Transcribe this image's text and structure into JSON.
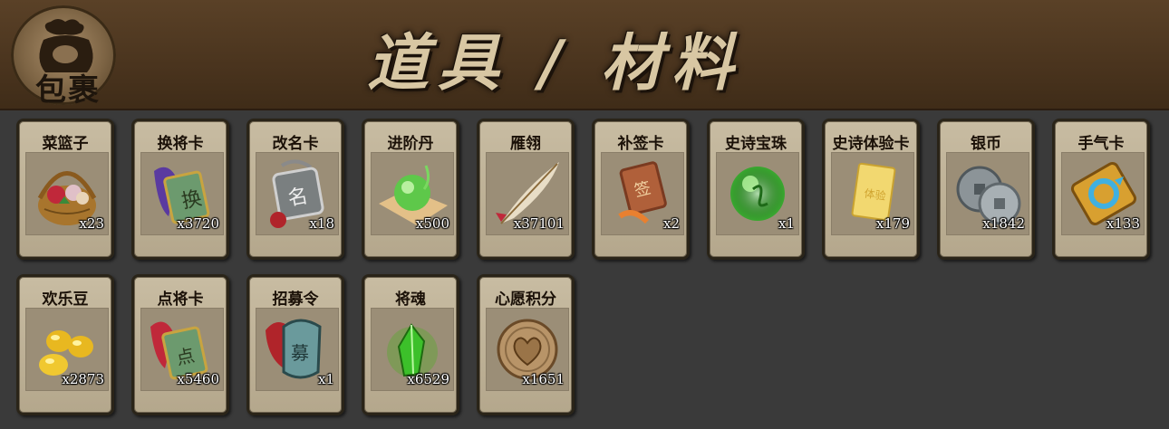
{
  "header": {
    "bag_label": "包裹",
    "title": "道具 / 材料"
  },
  "items": [
    {
      "name": "菜篮子",
      "count": "x23",
      "icon": "basket-icon"
    },
    {
      "name": "换将卡",
      "count": "x3720",
      "icon": "swap-card-icon"
    },
    {
      "name": "改名卡",
      "count": "x18",
      "icon": "rename-card-icon"
    },
    {
      "name": "进阶丹",
      "count": "x500",
      "icon": "advance-pill-icon"
    },
    {
      "name": "雁翎",
      "count": "x37101",
      "icon": "feather-icon"
    },
    {
      "name": "补签卡",
      "count": "x2",
      "icon": "sign-card-icon"
    },
    {
      "name": "史诗宝珠",
      "count": "x1",
      "icon": "epic-orb-icon"
    },
    {
      "name": "史诗体验卡",
      "count": "x179",
      "icon": "epic-trial-card-icon"
    },
    {
      "name": "银币",
      "count": "x1842",
      "icon": "silver-coin-icon"
    },
    {
      "name": "手气卡",
      "count": "x133",
      "icon": "luck-card-icon"
    },
    {
      "name": "欢乐豆",
      "count": "x2873",
      "icon": "joy-bean-icon"
    },
    {
      "name": "点将卡",
      "count": "x5460",
      "icon": "pick-general-card-icon"
    },
    {
      "name": "招募令",
      "count": "x1",
      "icon": "recruit-token-icon"
    },
    {
      "name": "将魂",
      "count": "x6529",
      "icon": "general-soul-icon"
    },
    {
      "name": "心愿积分",
      "count": "x1651",
      "icon": "wish-coin-icon"
    }
  ],
  "colors": {
    "header_bg": "#4a341e",
    "page_bg": "#3a3a3a",
    "card_bg": "#c8bca2",
    "title": "#d8c7a3"
  }
}
